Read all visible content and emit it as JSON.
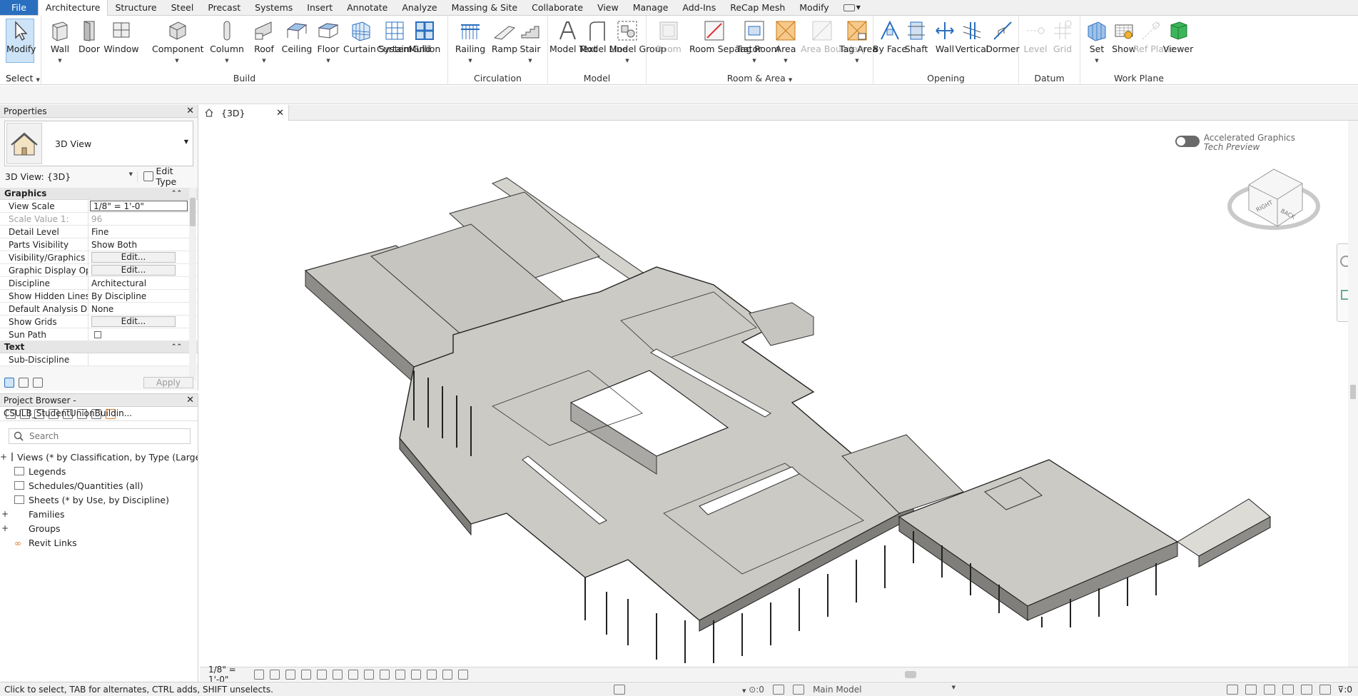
{
  "menu": {
    "tabs": [
      "File",
      "Architecture",
      "Structure",
      "Steel",
      "Precast",
      "Systems",
      "Insert",
      "Annotate",
      "Analyze",
      "Massing & Site",
      "Collaborate",
      "View",
      "Manage",
      "Add-Ins",
      "ReCap Mesh",
      "Modify"
    ],
    "active": "Architecture"
  },
  "ribbon": {
    "select": {
      "modify": "Modify",
      "select_label": "Select"
    },
    "groups": {
      "build": {
        "label": "Build",
        "tools": [
          "Wall",
          "Door",
          "Window",
          "Component",
          "Column",
          "Roof",
          "Ceiling",
          "Floor",
          "Curtain System",
          "Curtain Grid",
          "Mullion"
        ]
      },
      "circulation": {
        "label": "Circulation",
        "tools": [
          "Railing",
          "Ramp",
          "Stair"
        ]
      },
      "model": {
        "label": "Model",
        "tools": [
          "Model Text",
          "Model Line",
          "Model Group"
        ]
      },
      "room_area": {
        "label": "Room & Area",
        "tools": [
          "Room",
          "Room Separator",
          "Tag Room",
          "Area",
          "Area Boundary",
          "Tag Area"
        ]
      },
      "opening": {
        "label": "Opening",
        "tools": [
          "By Face",
          "Shaft",
          "Wall",
          "Vertical",
          "Dormer"
        ]
      },
      "datum": {
        "label": "Datum",
        "tools": [
          "Level",
          "Grid"
        ]
      },
      "work_plane": {
        "label": "Work Plane",
        "tools": [
          "Set",
          "Show",
          "Ref Plane",
          "Viewer"
        ]
      }
    }
  },
  "properties": {
    "title": "Properties",
    "type_name": "3D View",
    "instance_selector": "3D View: {3D}",
    "edit_type": "Edit Type",
    "sections": [
      {
        "name": "Graphics",
        "rows": [
          {
            "name": "View Scale",
            "value": "1/8\" = 1'-0\"",
            "kind": "boxed"
          },
          {
            "name": "Scale Value    1:",
            "value": "96",
            "kind": "disabled"
          },
          {
            "name": "Detail Level",
            "value": "Fine",
            "kind": "text"
          },
          {
            "name": "Parts Visibility",
            "value": "Show Both",
            "kind": "text"
          },
          {
            "name": "Visibility/Graphics ...",
            "value": "Edit...",
            "kind": "button"
          },
          {
            "name": "Graphic Display Op...",
            "value": "Edit...",
            "kind": "button"
          },
          {
            "name": "Discipline",
            "value": "Architectural",
            "kind": "text"
          },
          {
            "name": "Show Hidden Lines",
            "value": "By Discipline",
            "kind": "text"
          },
          {
            "name": "Default Analysis Di...",
            "value": "None",
            "kind": "text"
          },
          {
            "name": "Show Grids",
            "value": "Edit...",
            "kind": "button"
          },
          {
            "name": "Sun Path",
            "value": "",
            "kind": "checkbox"
          }
        ]
      },
      {
        "name": "Text",
        "rows": [
          {
            "name": "Sub-Discipline",
            "value": "",
            "kind": "text"
          }
        ]
      }
    ],
    "apply": "Apply"
  },
  "browser": {
    "title": "Project Browser - CSULB_StudentUnionBuildin...",
    "search_placeholder": "Search",
    "items": [
      {
        "label": "Views (* by Classification, by Type (Large Pr",
        "expandable": true
      },
      {
        "label": "Legends",
        "expandable": false
      },
      {
        "label": "Schedules/Quantities (all)",
        "expandable": false
      },
      {
        "label": "Sheets (* by Use, by Discipline)",
        "expandable": false
      },
      {
        "label": "Families",
        "expandable": true
      },
      {
        "label": "Groups",
        "expandable": true
      },
      {
        "label": "Revit Links",
        "expandable": false
      }
    ]
  },
  "view": {
    "tab_label": "{3D}",
    "accel_title": "Accelerated Graphics",
    "accel_sub": "Tech Preview",
    "viewcube_right": "RIGHT",
    "viewcube_back": "BACK",
    "scale": "1/8\" = 1'-0\""
  },
  "status": {
    "hint": "Click to select, TAB for alternates, CTRL adds, SHIFT unselects.",
    "count_left": ":0",
    "model": "Main Model",
    "filter_count": ":0"
  }
}
